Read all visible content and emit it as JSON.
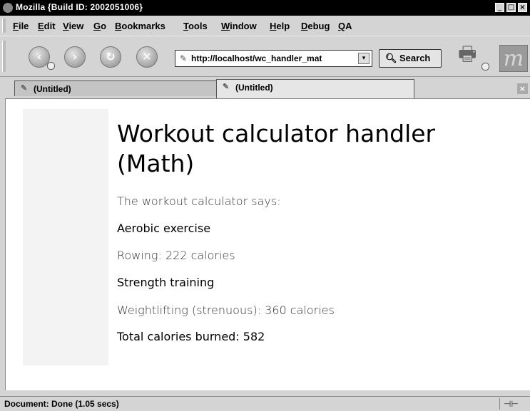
{
  "window": {
    "title": "Mozilla {Build ID: 2002051006}",
    "controls": [
      "_",
      "□",
      "×"
    ]
  },
  "menu": {
    "items": [
      {
        "accel": "F",
        "rest": "ile"
      },
      {
        "accel": "E",
        "rest": "dit"
      },
      {
        "accel": "V",
        "rest": "iew"
      },
      {
        "accel": "G",
        "rest": "o"
      },
      {
        "accel": "B",
        "rest": "ookmarks"
      },
      {
        "accel": "T",
        "rest": "ools"
      },
      {
        "accel": "W",
        "rest": "indow"
      },
      {
        "accel": "H",
        "rest": "elp"
      },
      {
        "accel": "D",
        "rest": "ebug"
      },
      {
        "accel": "Q",
        "rest": "A"
      }
    ]
  },
  "toolbar": {
    "url": "http://localhost/wc_handler_mat",
    "search_label": "Search",
    "icons": [
      "back-icon",
      "forward-icon",
      "reload-icon",
      "stop-icon",
      "print-icon",
      "mozilla-logo-icon"
    ]
  },
  "tabs": [
    {
      "label": "(Untitled)",
      "active": false
    },
    {
      "label": "(Untitled)",
      "active": true
    }
  ],
  "page": {
    "heading": "Workout calculator handler (Math)",
    "intro": "The workout calculator says:",
    "section1_title": "Aerobic exercise",
    "section1_line": "Rowing: 222 calories",
    "section2_title": "Strength training",
    "section2_line": "Weightlifting (strenuous): 360 calories",
    "total": "Total calories burned: 582"
  },
  "status": {
    "text": "Document: Done (1.05 secs)"
  }
}
